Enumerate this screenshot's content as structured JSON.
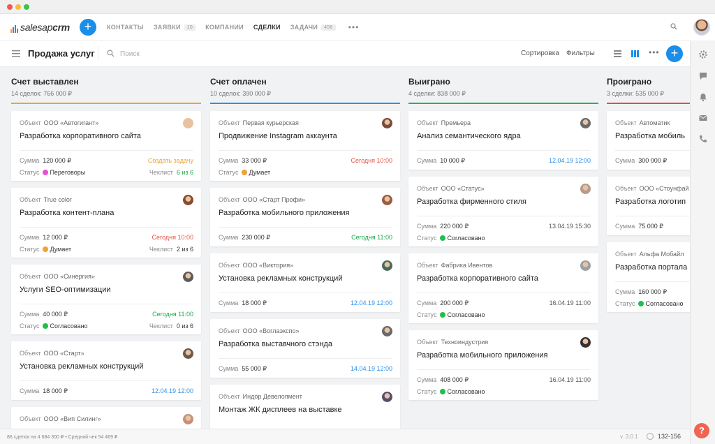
{
  "app": {
    "logo_regular": "salesap",
    "logo_bold": "crm"
  },
  "nav": [
    {
      "label": "КОНТАКТЫ",
      "badge": "",
      "active": false
    },
    {
      "label": "ЗАЯВКИ",
      "badge": "10",
      "active": false
    },
    {
      "label": "КОМПАНИИ",
      "badge": "",
      "active": false
    },
    {
      "label": "СДЕЛКИ",
      "badge": "",
      "active": true
    },
    {
      "label": "ЗАДАЧИ",
      "badge": "456",
      "active": false
    }
  ],
  "toolbar": {
    "title": "Продажа услуг",
    "search_placeholder": "Поиск",
    "sort_label": "Сортировка",
    "filter_label": "Фильтры",
    "more_label": "•••",
    "add_label": "+"
  },
  "labels": {
    "object": "Объект",
    "sum": "Сумма",
    "status": "Статус",
    "checklist": "Чеклист"
  },
  "colors": {
    "accent": "#1a8ee9",
    "col_invoiced": "#f0a233",
    "col_paid": "#2d8fe6",
    "col_won": "#2bb24c",
    "col_lost": "#e94a3f",
    "status_negotiation": "#e94fd6",
    "status_thinking": "#f0a233",
    "status_agreed": "#1fbf4c",
    "text_orange": "#f0a233",
    "text_red": "#e9574a",
    "text_green": "#1aa84a",
    "text_blue": "#2d8fe6",
    "text_gray": "#555555"
  },
  "columns": [
    {
      "title": "Счет выставлен",
      "meta": "14 сделок:  766 000 ₽",
      "color": "#f0a233",
      "cards": [
        {
          "object": "ООО «Автогигант»",
          "title": "Разработка корпоративного сайта",
          "sum": "120 000 ₽",
          "right": "Создать задачу",
          "right_color": "#f0a233",
          "status": "Переговоры",
          "status_color": "#e94fd6",
          "checklist": "6 из 6",
          "check_color": "#1aa84a",
          "avatar": "#e8c29a"
        },
        {
          "object": "True color",
          "title": "Разработка контент-плана",
          "sum": "12 000 ₽",
          "right": "Сегодня 10:00",
          "right_color": "#e9574a",
          "status": "Думает",
          "status_color": "#f0a233",
          "checklist": "2 из 6",
          "check_color": "#333333",
          "avatar": "#8a4a2c"
        },
        {
          "object": "ООО «Синергия»",
          "title": "Услуги SEO-оптимизации",
          "sum": "40 000 ₽",
          "right": "Сегодня 11:00",
          "right_color": "#1aa84a",
          "status": "Согласовано",
          "status_color": "#1fbf4c",
          "checklist": "0 из 6",
          "check_color": "#333333",
          "avatar": "#5b5b5b"
        },
        {
          "object": "ООО «Старт»",
          "title": "Установка рекламных конструкций",
          "sum": "18 000 ₽",
          "right": "12.04.19 12:00",
          "right_color": "#2d8fe6",
          "status": "",
          "status_color": "",
          "checklist": "",
          "check_color": "",
          "avatar": "#6e5a47"
        },
        {
          "object": "ООО «Вип Силинг»",
          "title": "",
          "sum": "",
          "right": "",
          "right_color": "",
          "status": "",
          "status_color": "",
          "checklist": "",
          "check_color": "",
          "avatar": "#c98f7c"
        }
      ]
    },
    {
      "title": "Счет оплачен",
      "meta": "10 сделок:  390 000 ₽",
      "color": "#2d8fe6",
      "cards": [
        {
          "object": "Первая курьерская",
          "title": "Продвижение Instagram аккаунта",
          "sum": "33 000 ₽",
          "right": "Сегодня 10:00",
          "right_color": "#e9574a",
          "status": "Думает",
          "status_color": "#f0a233",
          "checklist": "",
          "check_color": "",
          "avatar": "#7a4b3a"
        },
        {
          "object": "ООО «Старт Профи»",
          "title": "Разработка мобильного приложения",
          "sum": "230 000 ₽",
          "right": "Сегодня 11:00",
          "right_color": "#1aa84a",
          "status": "",
          "status_color": "",
          "checklist": "",
          "check_color": "",
          "avatar": "#9a5d3e"
        },
        {
          "object": "ООО «Виктория»",
          "title": "Установка рекламных конструкций",
          "sum": "18 000 ₽",
          "right": "12.04.19 12:00",
          "right_color": "#2d8fe6",
          "status": "",
          "status_color": "",
          "checklist": "",
          "check_color": "",
          "avatar": "#4a6b5c"
        },
        {
          "object": "ООО «Воглаэкспо»",
          "title": "Разработка выставчного стэнда",
          "sum": "55 000 ₽",
          "right": "14.04.19 12:00",
          "right_color": "#2d8fe6",
          "status": "",
          "status_color": "",
          "checklist": "",
          "check_color": "",
          "avatar": "#6a6a6a"
        },
        {
          "object": "Индор Девелопмент",
          "title": "Монтаж ЖК дисплеев на выставке",
          "sum": "",
          "right": "",
          "right_color": "",
          "status": "",
          "status_color": "",
          "checklist": "",
          "check_color": "",
          "avatar": "#5a4e6a"
        }
      ]
    },
    {
      "title": "Выиграно",
      "meta": "4 сделки:  838 000 ₽",
      "color": "#2bb24c",
      "cards": [
        {
          "object": "Премьера",
          "title": "Анализ семантического ядра",
          "sum": "10 000 ₽",
          "right": "12.04.19 12:00",
          "right_color": "#2d8fe6",
          "status": "",
          "status_color": "",
          "checklist": "",
          "check_color": "",
          "avatar": "#6a6a6a"
        },
        {
          "object": "ООО «Статус»",
          "title": "Разработка фирменного стиля",
          "sum": "220 000 ₽",
          "right": "13.04.19 15:30",
          "right_color": "#555555",
          "status": "Согласовано",
          "status_color": "#1fbf4c",
          "checklist": "",
          "check_color": "",
          "avatar": "#b89a8a"
        },
        {
          "object": "Фабрика Ивентов",
          "title": "Разработка корпоративного сайта",
          "sum": "200 000 ₽",
          "right": "16.04.19 11:00",
          "right_color": "#555555",
          "status": "Согласовано",
          "status_color": "#1fbf4c",
          "checklist": "",
          "check_color": "",
          "avatar": "#9aa0a6"
        },
        {
          "object": "Техноиндустрия",
          "title": "Разработка мобильного приложения",
          "sum": "408 000 ₽",
          "right": "16.04.19 11:00",
          "right_color": "#555555",
          "status": "Согласовано",
          "status_color": "#1fbf4c",
          "checklist": "",
          "check_color": "",
          "avatar": "#3b3030"
        }
      ]
    },
    {
      "title": "Проиграно",
      "meta": "3 сделки:  535 000 ₽",
      "color": "#e94a3f",
      "cards": [
        {
          "object": "Автоматик",
          "title": "Разработка мобиль",
          "sum": "300 000 ₽",
          "right": "",
          "right_color": "",
          "status": "",
          "status_color": "",
          "checklist": "",
          "check_color": "",
          "avatar": ""
        },
        {
          "object": "ООО «Стоунфай",
          "title": "Разработка логотип",
          "sum": "75 000 ₽",
          "right": "",
          "right_color": "",
          "status": "",
          "status_color": "",
          "checklist": "",
          "check_color": "",
          "avatar": ""
        },
        {
          "object": "Альфа Мобайл",
          "title": "Разработка портала",
          "sum": "160 000 ₽",
          "right": "",
          "right_color": "",
          "status": "Согласовано",
          "status_color": "#1fbf4c",
          "checklist": "",
          "check_color": "",
          "avatar": ""
        }
      ]
    }
  ],
  "footer": {
    "summary": "86 сделок на 4 684 300 ₽  •  Средний чек 54 469 ₽",
    "version": "v. 3.0.1",
    "count": "132-156"
  },
  "help_label": "?"
}
